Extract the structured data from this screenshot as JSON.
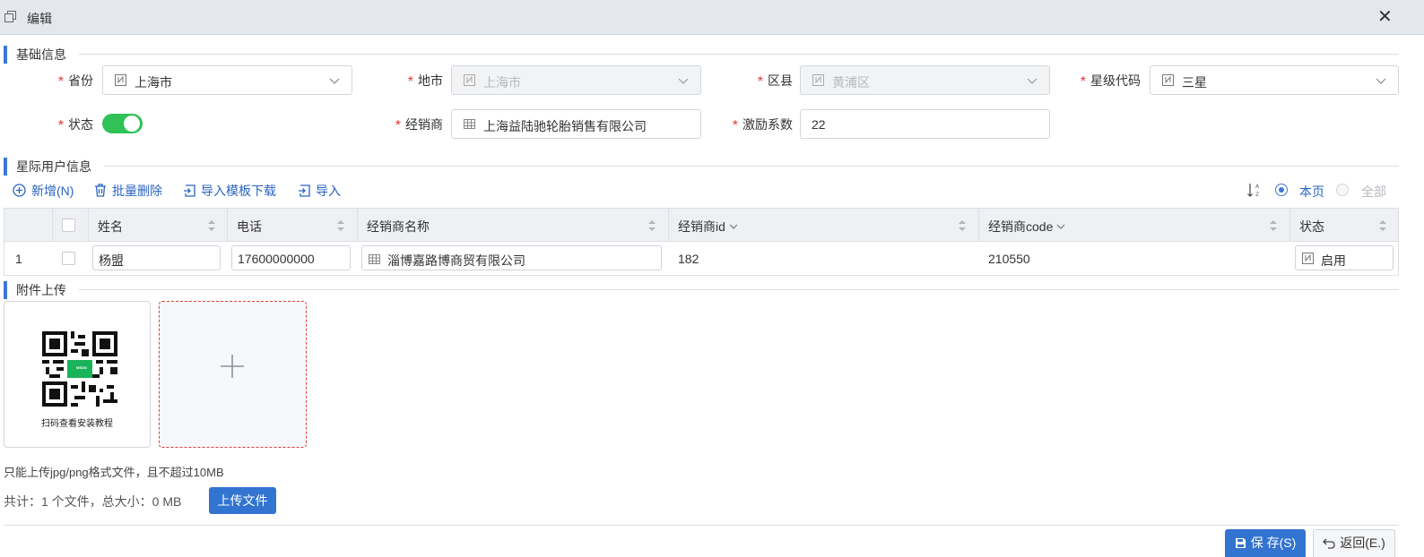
{
  "window": {
    "title": "编辑"
  },
  "sections": {
    "basic": "基础信息",
    "users": "星际用户信息",
    "attachments": "附件上传"
  },
  "form": {
    "province": {
      "label": "省份",
      "value": "上海市"
    },
    "city": {
      "label": "地市",
      "value": "上海市"
    },
    "district": {
      "label": "区县",
      "value": "黄浦区"
    },
    "star_code": {
      "label": "星级代码",
      "value": "三星"
    },
    "status": {
      "label": "状态",
      "enabled": true
    },
    "dealer": {
      "label": "经销商",
      "value": "上海益陆驰轮胎销售有限公司"
    },
    "incentive": {
      "label": "激励系数",
      "value": "22"
    }
  },
  "toolbar": {
    "add": "新增(N)",
    "batch_delete": "批量删除",
    "download_template": "导入模板下载",
    "import": "导入",
    "scope_current": "本页",
    "scope_all": "全部",
    "scope_selected": "current"
  },
  "table": {
    "columns": [
      "姓名",
      "电话",
      "经销商名称",
      "经销商id",
      "经销商code",
      "状态"
    ],
    "rows": [
      {
        "index": "1",
        "name": "杨盟",
        "phone": "17600000000",
        "dealer_name": "淄博嘉路博商贸有限公司",
        "dealer_id": "182",
        "dealer_code": "210550",
        "status": "启用"
      }
    ]
  },
  "upload": {
    "qr_caption": "扫码查看安装教程",
    "qr_badge": "MSDN",
    "hint": "只能上传jpg/png格式文件，且不超过10MB",
    "summary": "共计：1 个文件，总大小：0 MB",
    "upload_button": "上传文件"
  },
  "footer": {
    "save": "保 存(S)",
    "back": "返回(E.)"
  },
  "colors": {
    "accent": "#3c78d8",
    "primary_button": "#3274d0",
    "toggle_on": "#30c256",
    "required": "#e53935"
  }
}
